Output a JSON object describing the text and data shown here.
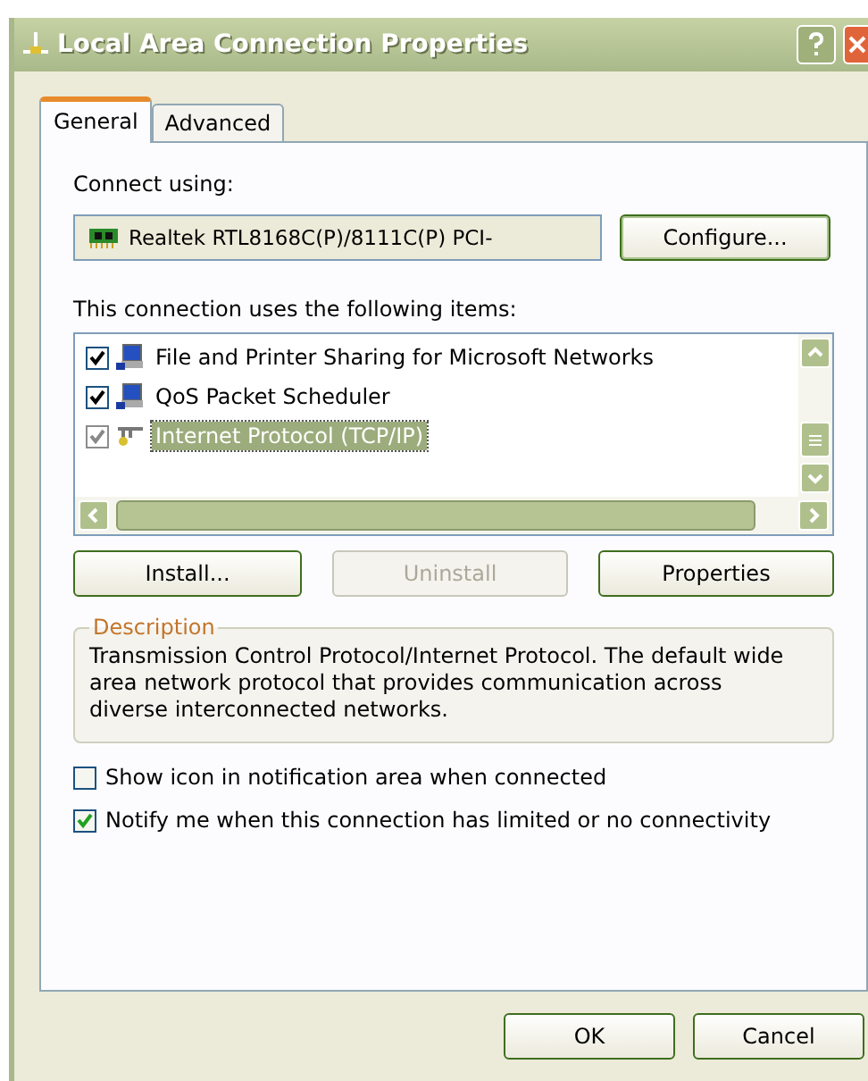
{
  "window": {
    "title": "Local Area Connection Properties"
  },
  "tabs": [
    {
      "label": "General",
      "selected": true
    },
    {
      "label": "Advanced",
      "selected": false
    }
  ],
  "connect_using": {
    "label": "Connect using:",
    "adapter": "Realtek RTL8168C(P)/8111C(P) PCI-",
    "button": "Configure..."
  },
  "items_label": "This connection uses the following items:",
  "items": [
    {
      "label": "File and Printer Sharing for Microsoft Networks",
      "kind": "computer",
      "checked": true,
      "selected": false
    },
    {
      "label": "QoS Packet Scheduler",
      "kind": "computer",
      "checked": true,
      "selected": false
    },
    {
      "label": "Internet Protocol (TCP/IP)",
      "kind": "protocol",
      "checked": true,
      "selected": true
    }
  ],
  "item_buttons": [
    {
      "label": "Install...",
      "disabled": false
    },
    {
      "label": "Uninstall",
      "disabled": true
    },
    {
      "label": "Properties",
      "disabled": false
    }
  ],
  "description": {
    "title": "Description",
    "text": "Transmission Control Protocol/Internet Protocol. The default wide area network protocol that provides communication across diverse interconnected networks."
  },
  "options": [
    {
      "label": "Show icon in notification area when connected",
      "checked": false
    },
    {
      "label": "Notify me when this connection has limited or no connectivity",
      "checked": true
    }
  ],
  "buttons": [
    "OK",
    "Cancel"
  ]
}
